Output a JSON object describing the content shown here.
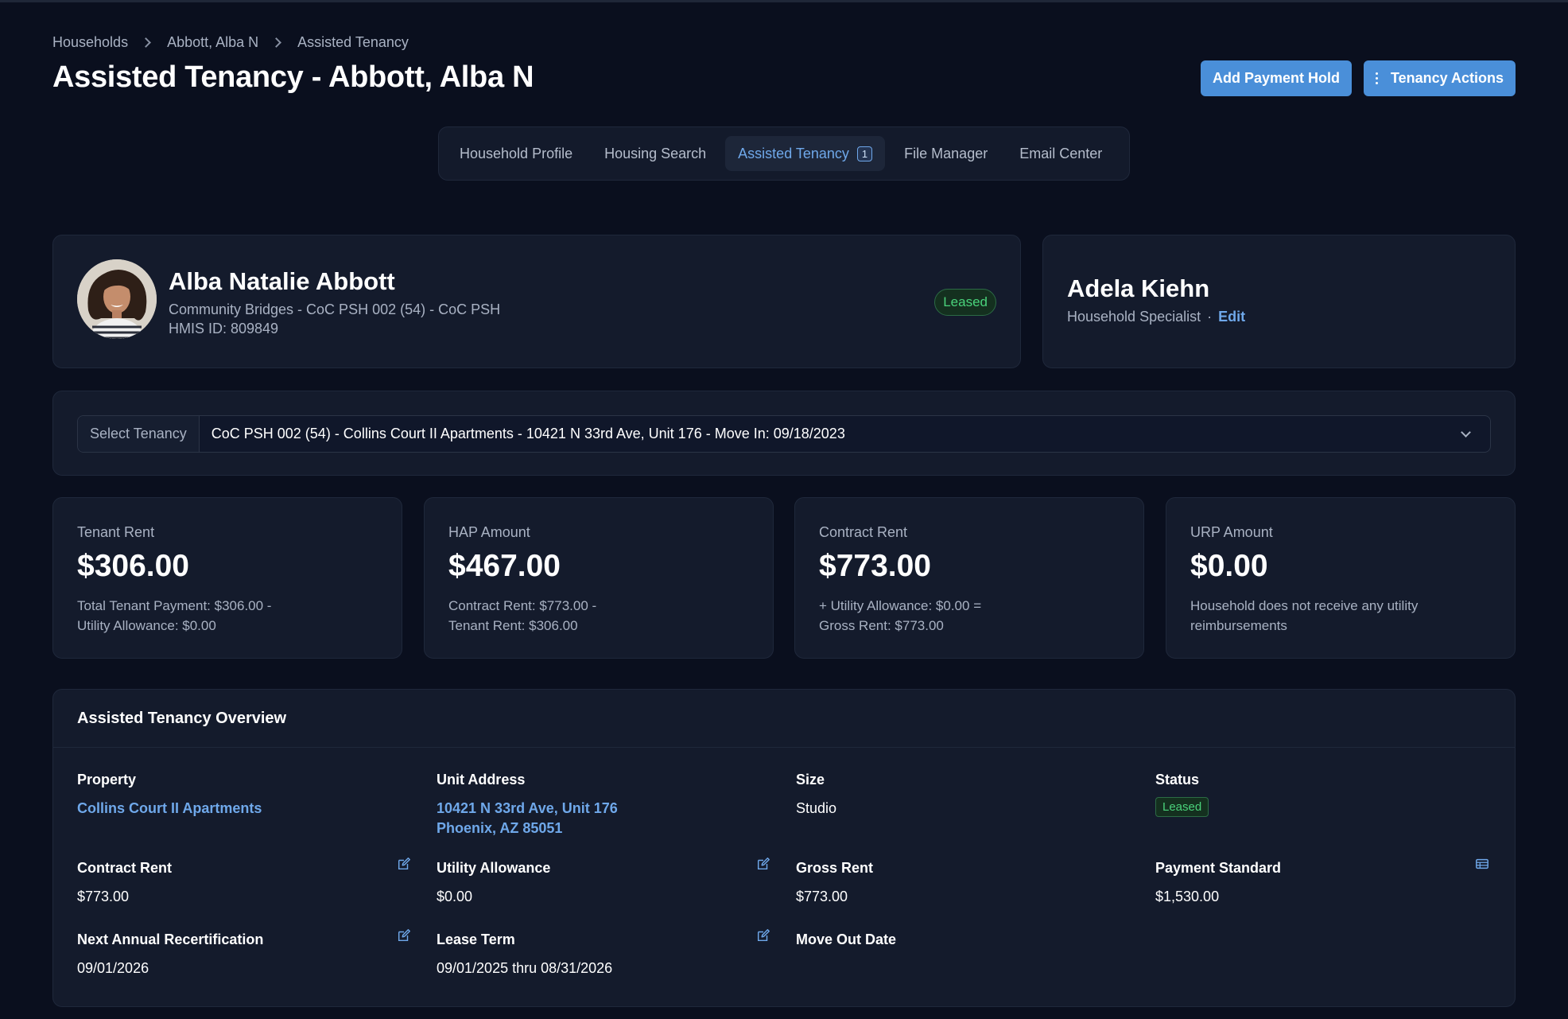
{
  "breadcrumb": [
    "Households",
    "Abbott, Alba N",
    "Assisted Tenancy"
  ],
  "page_title": "Assisted Tenancy - Abbott, Alba N",
  "actions": {
    "add_hold": "Add Payment Hold",
    "tenancy_actions": "Tenancy Actions"
  },
  "tabs": [
    {
      "label": "Household Profile"
    },
    {
      "label": "Housing Search"
    },
    {
      "label": "Assisted Tenancy",
      "count": "1"
    },
    {
      "label": "File Manager"
    },
    {
      "label": "Email Center"
    }
  ],
  "person": {
    "name": "Alba Natalie Abbott",
    "program": "Community Bridges - CoC PSH 002 (54) - CoC PSH",
    "hmis": "HMIS ID: 809849",
    "status": "Leased"
  },
  "specialist": {
    "name": "Adela Kiehn",
    "role": "Household Specialist",
    "sep": "·",
    "edit": "Edit"
  },
  "tenancy_select": {
    "label": "Select Tenancy",
    "value": "CoC PSH 002 (54) - Collins Court II Apartments - 10421 N 33rd Ave, Unit 176 - Move In: 09/18/2023"
  },
  "stats": [
    {
      "label": "Tenant Rent",
      "value": "$306.00",
      "note1": "Total Tenant Payment: $306.00 -",
      "note2": "Utility Allowance: $0.00"
    },
    {
      "label": "HAP Amount",
      "value": "$467.00",
      "note1": "Contract Rent: $773.00 -",
      "note2": "Tenant Rent: $306.00"
    },
    {
      "label": "Contract Rent",
      "value": "$773.00",
      "note1": "+ Utility Allowance: $0.00 =",
      "note2": "Gross Rent: $773.00"
    },
    {
      "label": "URP Amount",
      "value": "$0.00",
      "note1": "Household does not receive any utility",
      "note2": "reimbursements"
    }
  ],
  "overview": {
    "title": "Assisted Tenancy Overview",
    "property_label": "Property",
    "property_value": "Collins Court II Apartments",
    "unit_label": "Unit Address",
    "unit_line1": "10421 N 33rd Ave, Unit 176",
    "unit_line2": "Phoenix, AZ 85051",
    "size_label": "Size",
    "size_value": "Studio",
    "status_label": "Status",
    "status_value": "Leased",
    "contract_label": "Contract Rent",
    "contract_value": "$773.00",
    "utility_label": "Utility Allowance",
    "utility_value": "$0.00",
    "gross_label": "Gross Rent",
    "gross_value": "$773.00",
    "payment_label": "Payment Standard",
    "payment_value": "$1,530.00",
    "recert_label": "Next Annual Recertification",
    "recert_value": "09/01/2026",
    "lease_label": "Lease Term",
    "lease_value": "09/01/2025 thru 08/31/2026",
    "moveout_label": "Move Out Date"
  }
}
